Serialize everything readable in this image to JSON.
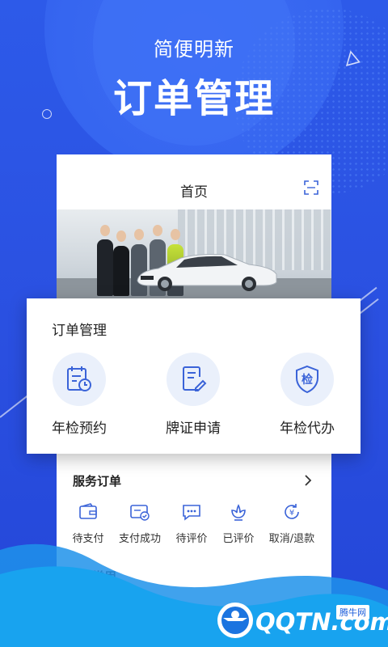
{
  "hero": {
    "subtitle": "简便明新",
    "title": "订单管理"
  },
  "phone": {
    "header_title": "首页",
    "order_card": {
      "title": "服务订单"
    },
    "order_statuses": [
      {
        "label": "待支付",
        "icon": "wallet-icon"
      },
      {
        "label": "支付成功",
        "icon": "card-check-icon"
      },
      {
        "label": "待评价",
        "icon": "chat-dots-icon"
      },
      {
        "label": "已评价",
        "icon": "flower-icon"
      },
      {
        "label": "取消/退款",
        "icon": "yen-refresh-icon"
      }
    ],
    "partial_section": "常用"
  },
  "popup": {
    "title": "订单管理",
    "features": [
      {
        "label": "年检预约",
        "icon": "calendar-clock-icon"
      },
      {
        "label": "牌证申请",
        "icon": "document-edit-icon"
      },
      {
        "label": "年检代办",
        "icon": "shield-check-icon",
        "glyph": "检"
      }
    ]
  },
  "branding": {
    "logo": "QQTN.com",
    "badge": "腾牛网"
  },
  "colors": {
    "primary": "#2f52e8",
    "accent_icon": "#3a63d8",
    "icon_bg": "#eaf0fb"
  }
}
